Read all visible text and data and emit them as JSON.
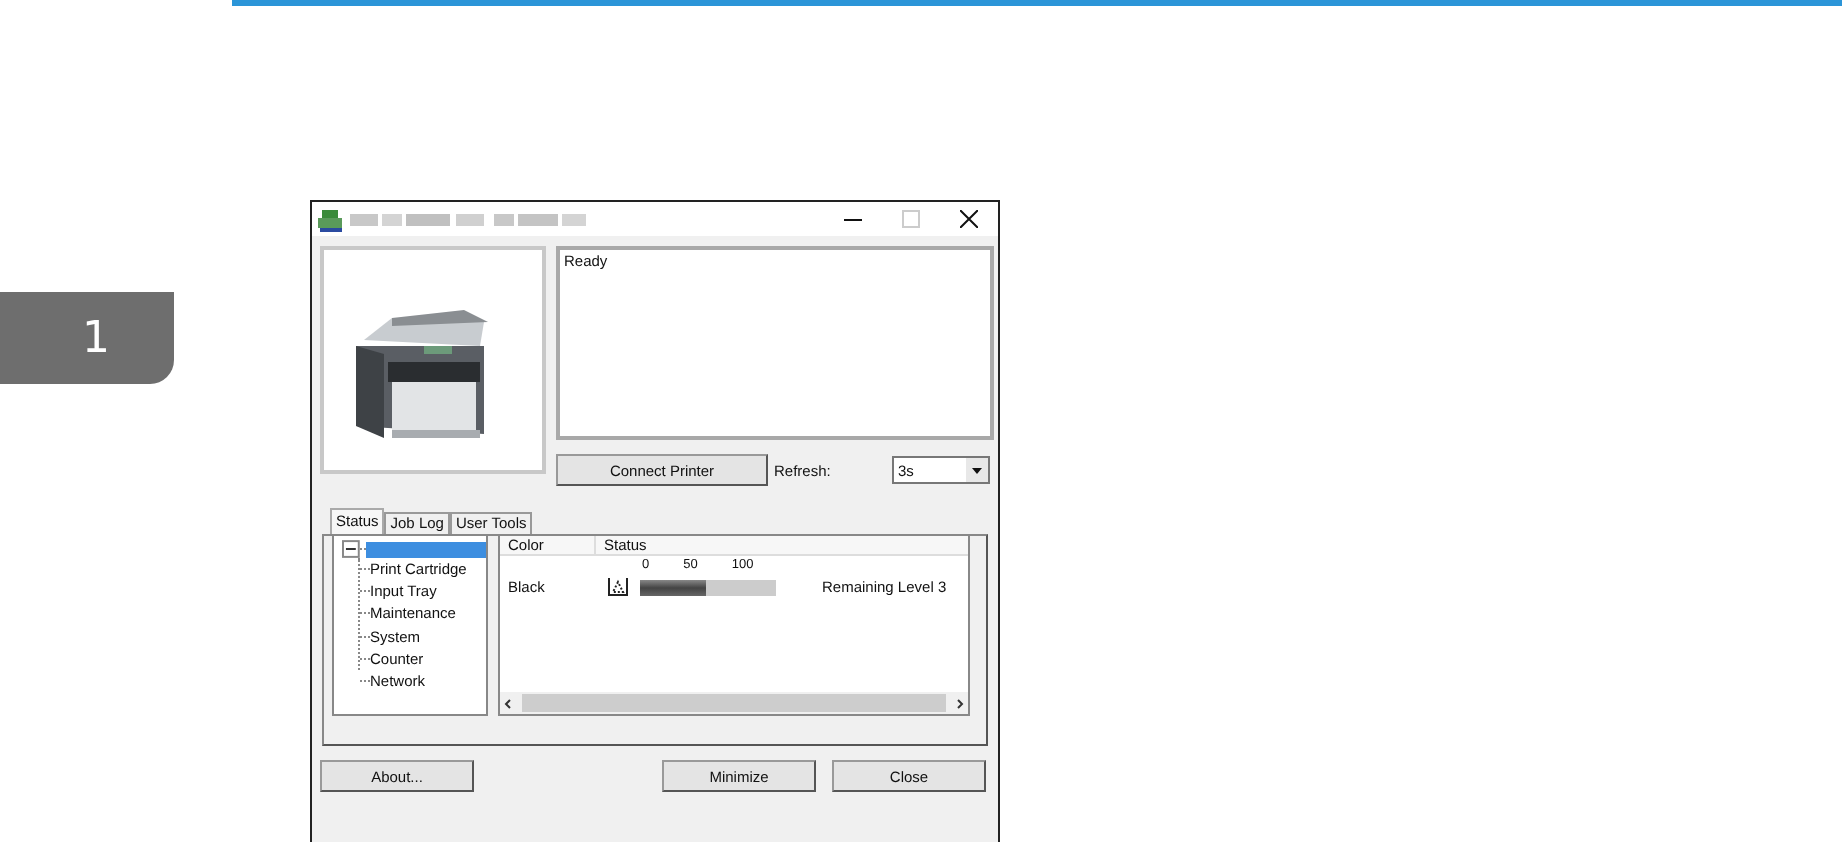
{
  "chapter_tab": {
    "label": "1"
  },
  "window": {
    "status_text": "Ready",
    "connect_button": "Connect Printer",
    "refresh": {
      "label": "Refresh:",
      "value": "3s"
    },
    "tabs": [
      {
        "label": "Status",
        "selected": true
      },
      {
        "label": "Job Log",
        "selected": false
      },
      {
        "label": "User Tools",
        "selected": false
      }
    ],
    "tree": {
      "expanded": true,
      "selected": true,
      "children": [
        {
          "label": "Print Cartridge",
          "selected": false
        },
        {
          "label": "Input Tray",
          "selected": false
        },
        {
          "label": "Maintenance",
          "selected": false
        },
        {
          "label": "System",
          "selected": false
        },
        {
          "label": "Counter",
          "selected": false
        },
        {
          "label": "Network",
          "selected": false
        }
      ]
    },
    "table": {
      "columns": [
        "Color",
        "Status"
      ],
      "scale": [
        "0",
        "50",
        "100"
      ],
      "rows": [
        {
          "name": "Black",
          "level": 0.49,
          "reading": "Remaining Level 3"
        }
      ]
    },
    "buttons": [
      "About...",
      "Minimize",
      "Close"
    ]
  }
}
